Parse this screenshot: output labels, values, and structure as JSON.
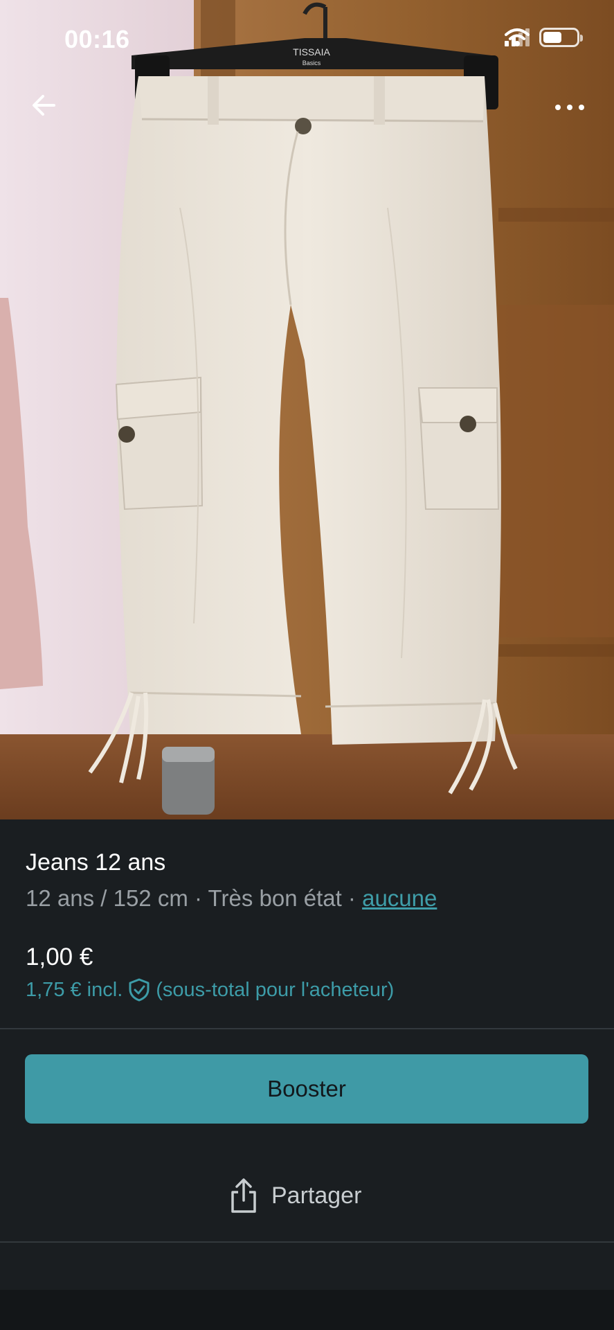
{
  "status_bar": {
    "time": "00:16"
  },
  "photo": {
    "hanger_brand_line1": "TISSAIA",
    "hanger_brand_line2": "Basics"
  },
  "nav": {
    "back_icon": "arrow-left-icon",
    "more_icon": "more-horizontal-icon"
  },
  "item": {
    "title": "Jeans 12 ans",
    "size": "12 ans / 152 cm",
    "separator": " · ",
    "condition": "Très bon état",
    "brand_link": "aucune",
    "price": "1,00 €",
    "price_incl": "1,75 € incl.",
    "price_note": "(sous-total pour l'acheteur)"
  },
  "actions": {
    "booster_label": "Booster",
    "share_label": "Partager"
  },
  "colors": {
    "accent": "#3f9aa6",
    "background": "#1a1e21",
    "muted_text": "#9aa0a5"
  }
}
